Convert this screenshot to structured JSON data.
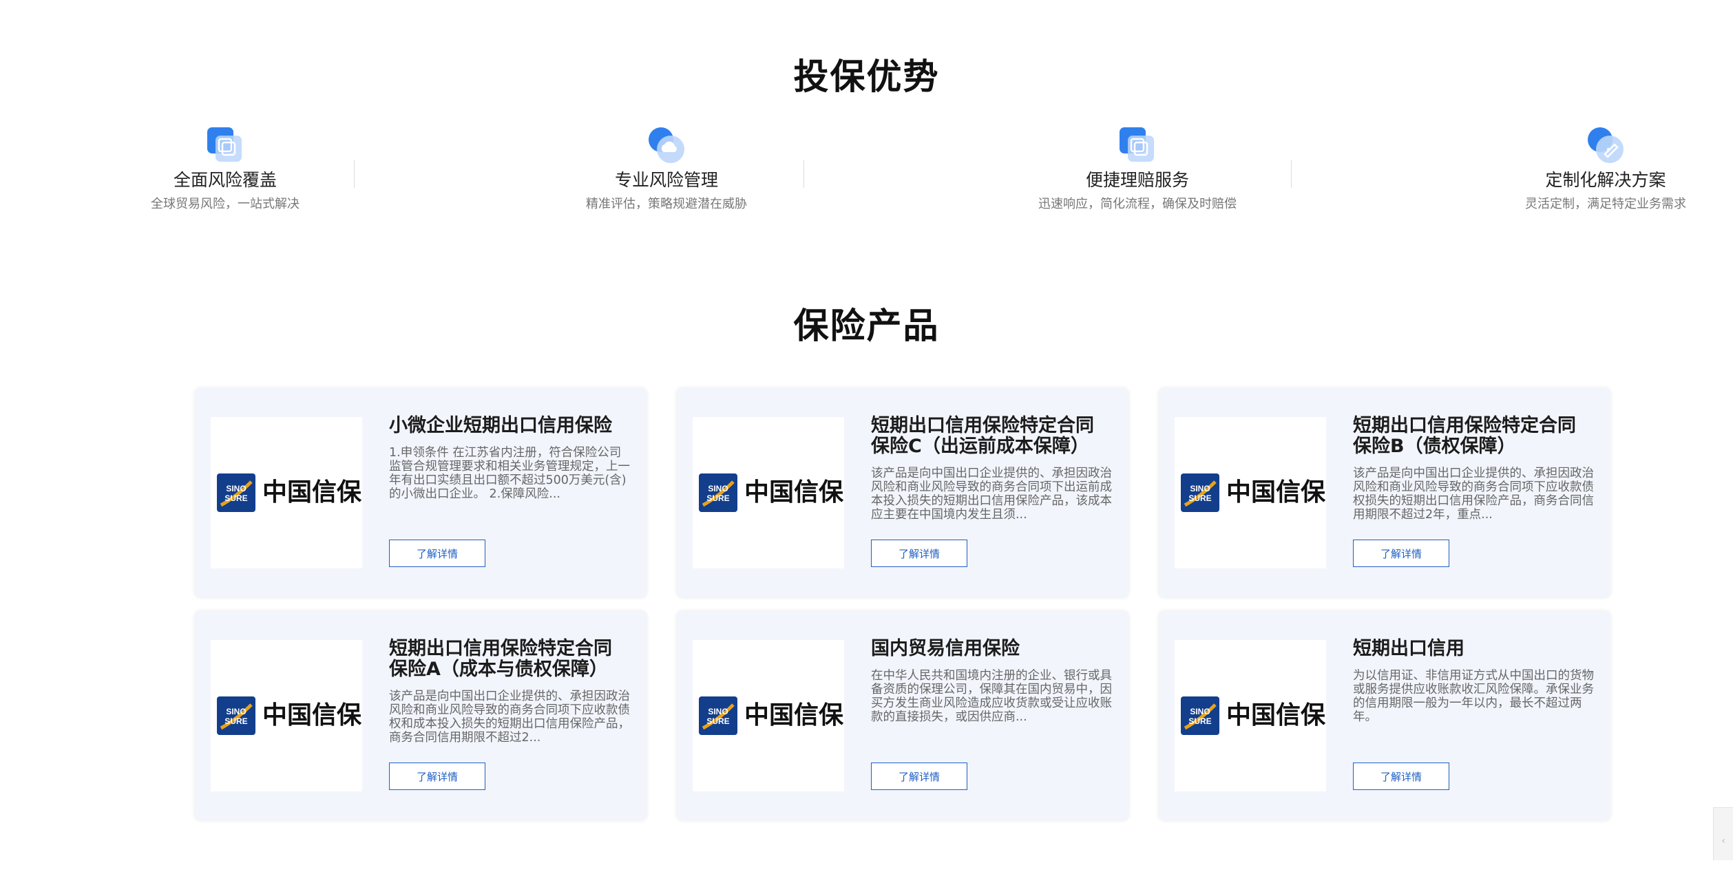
{
  "advantages": {
    "title": "投保优势",
    "items": [
      {
        "name": "全面风险覆盖",
        "desc": "全球贸易风险，一站式解决",
        "icon": "coverage-icon"
      },
      {
        "name": "专业风险管理",
        "desc": "精准评估，策略规避潜在威胁",
        "icon": "cloud-risk-icon"
      },
      {
        "name": "便捷理赔服务",
        "desc": "迅速响应，简化流程，确保及时赔偿",
        "icon": "claims-icon"
      },
      {
        "name": "定制化解决方案",
        "desc": "灵活定制，满足特定业务需求",
        "icon": "custom-solution-icon"
      }
    ]
  },
  "products": {
    "title": "保险产品",
    "button_label": "了解详情",
    "logo_text": "中国信保",
    "logo_emblem_text": "SINO SURE",
    "items": [
      {
        "title": "小微企业短期出口信用保险",
        "desc": "1.申领条件 在江苏省内注册，符合保险公司监管合规管理要求和相关业务管理规定，上一年有出口实绩且出口额不超过500万美元(含)的小微出口企业。 2.保障风险..."
      },
      {
        "title": "短期出口信用保险特定合同保险C（出运前成本保障）",
        "desc": "该产品是向中国出口企业提供的、承担因政治风险和商业风险导致的商务合同项下出运前成本投入损失的短期出口信用保险产品，该成本应主要在中国境内发生且须..."
      },
      {
        "title": "短期出口信用保险特定合同保险B（债权保障）",
        "desc": "该产品是向中国出口企业提供的、承担因政治风险和商业风险导致的商务合同项下应收款债权损失的短期出口信用保险产品，商务合同信用期限不超过2年，重点..."
      },
      {
        "title": "短期出口信用保险特定合同保险A（成本与债权保障）",
        "desc": "该产品是向中国出口企业提供的、承担因政治风险和商业风险导致的商务合同项下应收款债权和成本投入损失的短期出口信用保险产品，商务合同信用期限不超过2..."
      },
      {
        "title": "国内贸易信用保险",
        "desc": "在中华人民共和国境内注册的企业、银行或具备资质的保理公司，保障其在国内贸易中，因买方发生商业风险造成应收货款或受让应收账款的直接损失，或因供应商..."
      },
      {
        "title": "短期出口信用",
        "desc": "为以信用证、非信用证方式从中国出口的货物或服务提供应收账款收汇风险保障。承保业务的信用期限一般为一年以内，最长不超过两年。"
      }
    ]
  },
  "colors": {
    "accent_blue": "#1d5fc4",
    "icon_blue": "#2f80ed",
    "card_bg": "#f2f5fc"
  }
}
